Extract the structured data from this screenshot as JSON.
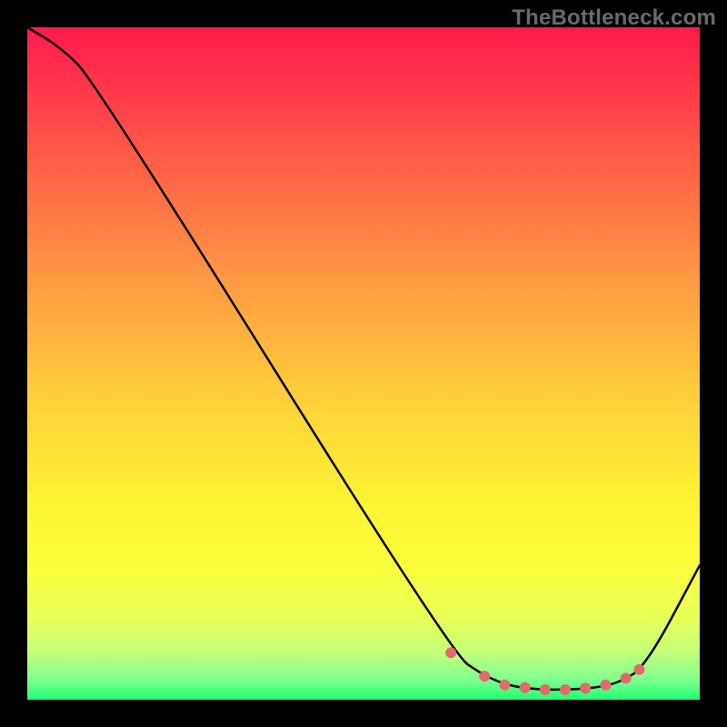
{
  "watermark": "TheBottleneck.com",
  "chart_data": {
    "type": "line",
    "title": "",
    "xlabel": "",
    "ylabel": "",
    "xlim": [
      0,
      100
    ],
    "ylim": [
      0,
      100
    ],
    "series": [
      {
        "name": "curve",
        "x": [
          0,
          5,
          10,
          63,
          68,
          72,
          76,
          80,
          84,
          88,
          92,
          100
        ],
        "values": [
          100,
          97,
          92,
          7,
          3.5,
          2,
          1.5,
          1.5,
          1.7,
          2.5,
          5,
          20
        ]
      }
    ],
    "markers": {
      "x": [
        63,
        68,
        71,
        74,
        77,
        80,
        83,
        86,
        89,
        91
      ],
      "values": [
        7,
        3.5,
        2.2,
        1.8,
        1.5,
        1.5,
        1.7,
        2.2,
        3.2,
        4.5
      ],
      "color": "#e36a6a",
      "radius": 6
    },
    "colors": {
      "line": "#000000",
      "marker": "#e36a6a",
      "gradient_top": "#ff1a4d",
      "gradient_bottom": "#21ff74"
    }
  }
}
